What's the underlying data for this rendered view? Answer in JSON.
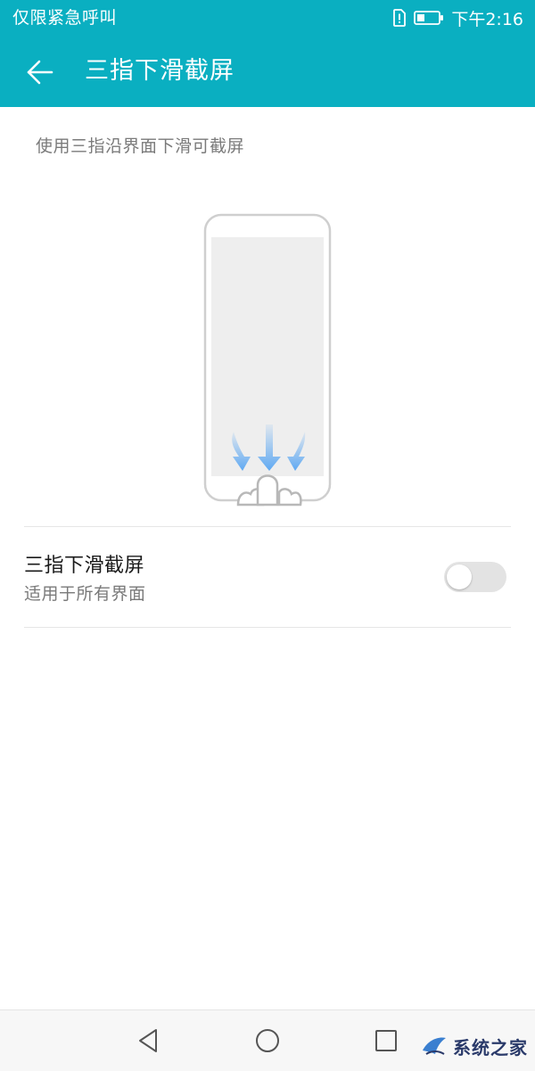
{
  "status_bar": {
    "carrier_text": "仅限紧急呼叫",
    "time": "下午2:16",
    "icons": [
      "sim-alert-icon",
      "battery-icon"
    ]
  },
  "app_bar": {
    "title": "三指下滑截屏",
    "back_icon": "arrow-left-icon"
  },
  "description": "使用三指沿界面下滑可截屏",
  "illustration": {
    "icons": [
      "phone-outline-icon",
      "swipe-down-arrow-icon",
      "hand-icon"
    ]
  },
  "setting": {
    "title": "三指下滑截屏",
    "subtitle": "适用于所有界面",
    "enabled": false
  },
  "nav_bar": {
    "icons": [
      "back-triangle-icon",
      "home-circle-icon",
      "recents-square-icon"
    ]
  },
  "watermark": {
    "text": "系统之家"
  },
  "colors": {
    "accent": "#0aafc1",
    "toggle_off": "#e3e3e3",
    "arrow": "#5fa9f2",
    "text_primary": "#1a1a1a",
    "text_secondary": "#7a7a7a"
  }
}
